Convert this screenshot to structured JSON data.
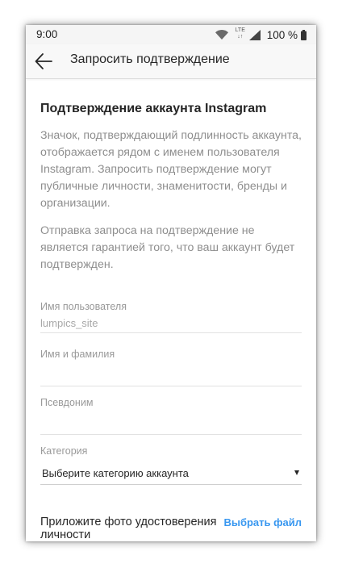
{
  "status_bar": {
    "time": "9:00",
    "network": "LTE",
    "battery": "100 %",
    "icons": [
      "wifi-icon",
      "lte-icon",
      "signal-icon",
      "battery-icon"
    ]
  },
  "app_bar": {
    "back_icon": "arrow-left-icon",
    "title": "Запросить подтверждение"
  },
  "main": {
    "heading": "Подтверждение аккаунта Instagram",
    "paragraph_1": "Значок, подтверждающий подлинность аккаунта, отображается рядом с именем пользователя Instagram. Запросить подтверждение могут публичные личности, знаменитости, бренды и организации.",
    "paragraph_2": "Отправка запроса на подтверждение не является гарантией того, что ваш аккаунт будет подтвержден.",
    "fields": {
      "username": {
        "label": "Имя пользователя",
        "value": "lumpics_site"
      },
      "full_name": {
        "label": "Имя и фамилия",
        "value": ""
      },
      "nickname": {
        "label": "Псевдоним",
        "value": ""
      }
    },
    "category": {
      "label": "Категория",
      "selected": "Выберите категорию аккаунта"
    },
    "upload": {
      "label": "Приложите фото удостоверения личности",
      "button": "Выбрать файл"
    }
  },
  "colors": {
    "accent": "#3897f0",
    "text_primary": "#262626",
    "text_secondary": "#8e8e8e",
    "app_bar_bg": "#f8f8f8"
  }
}
